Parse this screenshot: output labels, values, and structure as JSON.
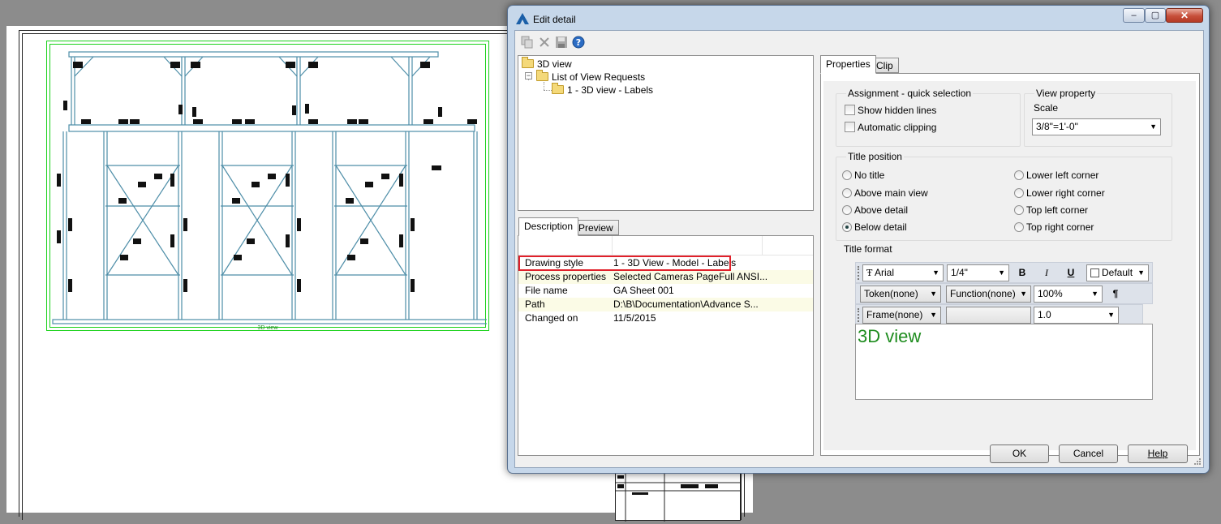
{
  "sheet": {
    "viewport_title": "3D view"
  },
  "dialog": {
    "title": "Edit detail",
    "caption_buttons": {
      "minimize": "–",
      "maximize": "▢",
      "close": "✕"
    }
  },
  "toolbar": {
    "icons": [
      "copy-icon",
      "delete-icon",
      "save-icon",
      "help-icon"
    ]
  },
  "tree": {
    "root": "3D view",
    "child": "List of View Requests",
    "grandchild": "1 - 3D view - Labels"
  },
  "left_tabs": {
    "description": "Description",
    "preview": "Preview"
  },
  "description": {
    "rows": [
      {
        "key": "Drawing style",
        "value": "1 - 3D View - Model - Labels"
      },
      {
        "key": "Process properties",
        "value": "Selected Cameras PageFull ANSI..."
      },
      {
        "key": "File name",
        "value": "GA Sheet 001"
      },
      {
        "key": "Path",
        "value": "D:\\B\\Documentation\\Advance S..."
      },
      {
        "key": "Changed on",
        "value": "11/5/2015"
      }
    ]
  },
  "right_tabs": {
    "properties": "Properties",
    "clip": "Clip"
  },
  "assignment": {
    "label": "Assignment - quick selection",
    "show_hidden_lines": "Show hidden lines",
    "automatic_clipping": "Automatic clipping"
  },
  "view_property": {
    "label": "View property",
    "scale_label": "Scale",
    "scale_value": "3/8\"=1'-0\""
  },
  "title_position": {
    "label": "Title position",
    "options": [
      "No title",
      "Above main view",
      "Above detail",
      "Below detail",
      "Lower left corner",
      "Lower right corner",
      "Top left corner",
      "Top right corner"
    ],
    "selected": "Below detail"
  },
  "title_format": {
    "label": "Title format",
    "font": "Arial",
    "size": "1/4\"",
    "bold": "B",
    "italic": "I",
    "underline": "U",
    "color": "Default",
    "token": "Token(none)",
    "function": "Function(none)",
    "width_percent": "100%",
    "paragraph": "¶",
    "frame": "Frame(none)",
    "spacing": "1.0",
    "preview_text": "3D view"
  },
  "buttons": {
    "ok": "OK",
    "cancel": "Cancel",
    "help": "Help"
  },
  "colors": {
    "highlight": "#e0202a",
    "title_green": "#1e8c1e",
    "viewport_green": "#1ad21a"
  }
}
